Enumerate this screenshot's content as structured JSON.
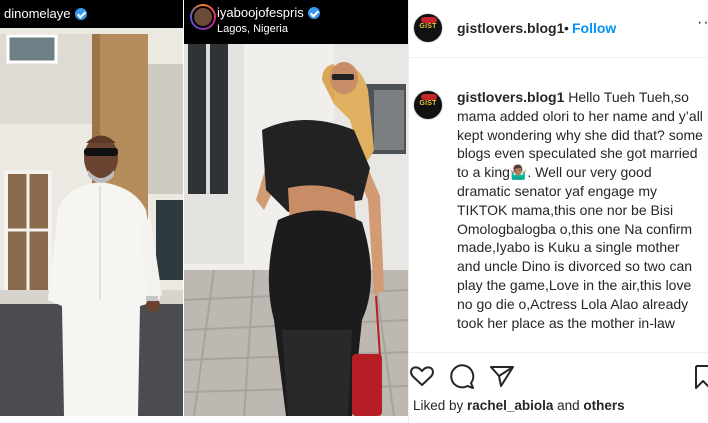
{
  "post": {
    "left_image": {
      "username": "dinomelaye"
    },
    "right_image": {
      "username": "iyaboojofespris",
      "location": "Lagos, Nigeria"
    }
  },
  "sidebar": {
    "header": {
      "avatar_text": "GIST",
      "username": "gistlovers.blog1",
      "separator": "•",
      "follow_label": "Follow",
      "more_label": "···"
    },
    "caption": {
      "username": "gistlovers.blog1",
      "text": " Hello Tueh Tueh,so mama added olori to her name and y’all kept wondering why she did that? some blogs even speculated she got married to a king🤷🏽‍♂️. Well our very good dramatic senator yaf engage my TIKTOK mama,this one nor be Bisi Omologbalogba o,this one Na confirm made,Iyabo is Kuku a single mother and uncle Dino is divorced so two can play the game,Love in the air,this love no go die o,Actress Lola Alao already took her place as the mother in-law"
    },
    "likes": {
      "prefix": "Liked by ",
      "user": "rachel_abiola",
      "middle": " and ",
      "others": "others"
    }
  },
  "colors": {
    "accent": "#0095f6",
    "verified": "#3897f0",
    "text": "#262626"
  },
  "icons": [
    "verified-badge-icon",
    "heart-icon",
    "comment-icon",
    "share-icon",
    "bookmark-icon",
    "more-icon"
  ]
}
